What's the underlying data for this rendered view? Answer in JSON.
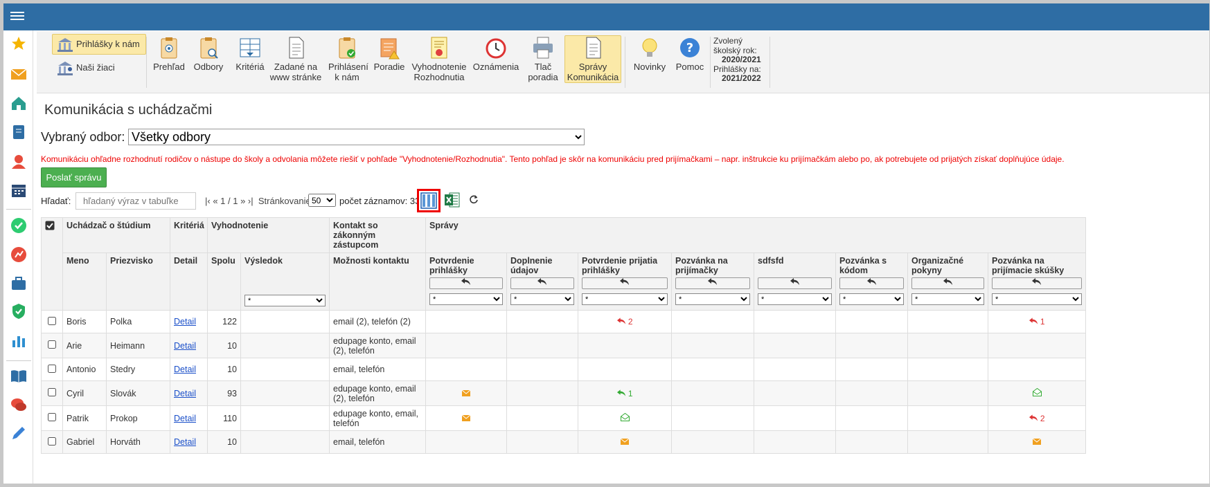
{
  "ribbon": {
    "left_buttons": [
      {
        "label": "Prihlášky k nám",
        "active": true
      },
      {
        "label": "Naši žiaci",
        "active": false
      }
    ],
    "buttons": [
      {
        "line1": "Prehľad",
        "line2": "",
        "icon": "clipboard-eye-icon"
      },
      {
        "line1": "Odbory",
        "line2": "",
        "icon": "clipboard-search-icon"
      },
      {
        "line1": "Kritériá",
        "line2": "",
        "icon": "criteria-table-icon"
      },
      {
        "line1": "Zadané na",
        "line2": "www stránke",
        "icon": "document-icon"
      },
      {
        "line1": "Prihlásení",
        "line2": "k nám",
        "icon": "clipboard-check-icon"
      },
      {
        "line1": "Poradie",
        "line2": "",
        "icon": "ranking-warning-icon"
      },
      {
        "line1": "Vyhodnotenie",
        "line2": "Rozhodnutia",
        "icon": "certificate-icon"
      },
      {
        "line1": "Oznámenia",
        "line2": "",
        "icon": "clock-icon"
      },
      {
        "line1": "Tlač",
        "line2": "poradia",
        "icon": "printer-icon"
      },
      {
        "line1": "Správy",
        "line2": "Komunikácia",
        "icon": "messages-document-icon",
        "active": true
      },
      {
        "line1": "Novinky",
        "line2": "",
        "icon": "lightbulb-icon"
      },
      {
        "line1": "Pomoc",
        "line2": "",
        "icon": "help-icon"
      }
    ],
    "year_info": {
      "line1": "Zvolený",
      "line2": "školský rok:",
      "year": "2020/2021",
      "line3": "Prihlášky na:",
      "apply_year": "2021/2022"
    }
  },
  "sidebar": {
    "icons": [
      "star-icon",
      "mail-icon",
      "home-icon",
      "notebook-icon",
      "person-icon",
      "calendar-icon",
      "check-circle-icon",
      "chart-red-icon",
      "briefcase-icon",
      "shield-check-icon",
      "bar-chart-icon",
      "book-icon",
      "chat-icon",
      "pencil-icon"
    ]
  },
  "page": {
    "title": "Komunikácia s uchádzačmi",
    "odbor_label": "Vybraný odbor:",
    "odbor_value": "Všetky odbory",
    "notice": "Komunikáciu ohľadne rozhodnutí rodičov o nástupe do školy a odvolania môžete riešiť v pohľade \"Vyhodnotenie/Rozhodnutia\". Tento pohľad je skôr na komunikáciu pred prijímačkami – napr. inštrukcie ku prijímačkám alebo po, ak potrebujete od prijatých získať doplňujúce údaje.",
    "send_button": "Poslať správu"
  },
  "toolbar": {
    "search_label": "Hľadať:",
    "search_placeholder": "hľadaný výraz v tabuľke",
    "pager": "|‹ « 1 / 1 » ›|",
    "paging_label": "Stránkovanie:",
    "page_size": "50",
    "count": "počet záznamov: 33"
  },
  "table": {
    "group_headers": {
      "student": "Uchádzač o štúdium",
      "criteria": "Kritériá",
      "evaluation": "Vyhodnotenie",
      "contact": "Kontakt so zákonným zástupcom",
      "messages": "Správy"
    },
    "columns": {
      "name": "Meno",
      "surname": "Priezvisko",
      "detail": "Detail",
      "total": "Spolu",
      "result": "Výsledok",
      "contact_options": "Možnosti kontaktu"
    },
    "message_columns": [
      "Potvrdenie prihlášky",
      "Doplnenie údajov",
      "Potvrdenie prijatia prihlášky",
      "Pozvánka na prijímačky",
      "sdfsfd",
      "Pozvánka s kódom",
      "Organizačné pokyny",
      "Pozvánka na prijímacie skúšky"
    ],
    "filter_value": "*",
    "detail_link": "Detail",
    "rows": [
      {
        "name": "Boris",
        "surname": "Polka",
        "total": "122",
        "contact": "email (2), telefón (2)",
        "msgs": [
          "",
          "",
          "reply-red:2",
          "",
          "",
          "",
          "",
          "reply-red:1"
        ]
      },
      {
        "name": "Arie",
        "surname": "Heimann",
        "total": "10",
        "contact": "edupage konto, email (2), telefón",
        "msgs": [
          "",
          "",
          "",
          "",
          "",
          "",
          "",
          ""
        ]
      },
      {
        "name": "Antonio",
        "surname": "Stedry",
        "total": "10",
        "contact": "email, telefón",
        "msgs": [
          "",
          "",
          "",
          "",
          "",
          "",
          "",
          ""
        ]
      },
      {
        "name": "Cyril",
        "surname": "Slovák",
        "total": "93",
        "contact": "edupage konto, email (2), telefón",
        "msgs": [
          "env",
          "",
          "reply-green:1",
          "",
          "",
          "",
          "",
          "open"
        ]
      },
      {
        "name": "Patrik",
        "surname": "Prokop",
        "total": "110",
        "contact": "edupage konto, email, telefón",
        "msgs": [
          "env",
          "",
          "open",
          "",
          "",
          "",
          "",
          "reply-red:2"
        ]
      },
      {
        "name": "Gabriel",
        "surname": "Horváth",
        "total": "10",
        "contact": "email, telefón",
        "msgs": [
          "",
          "",
          "env",
          "",
          "",
          "",
          "",
          "env"
        ]
      }
    ]
  }
}
